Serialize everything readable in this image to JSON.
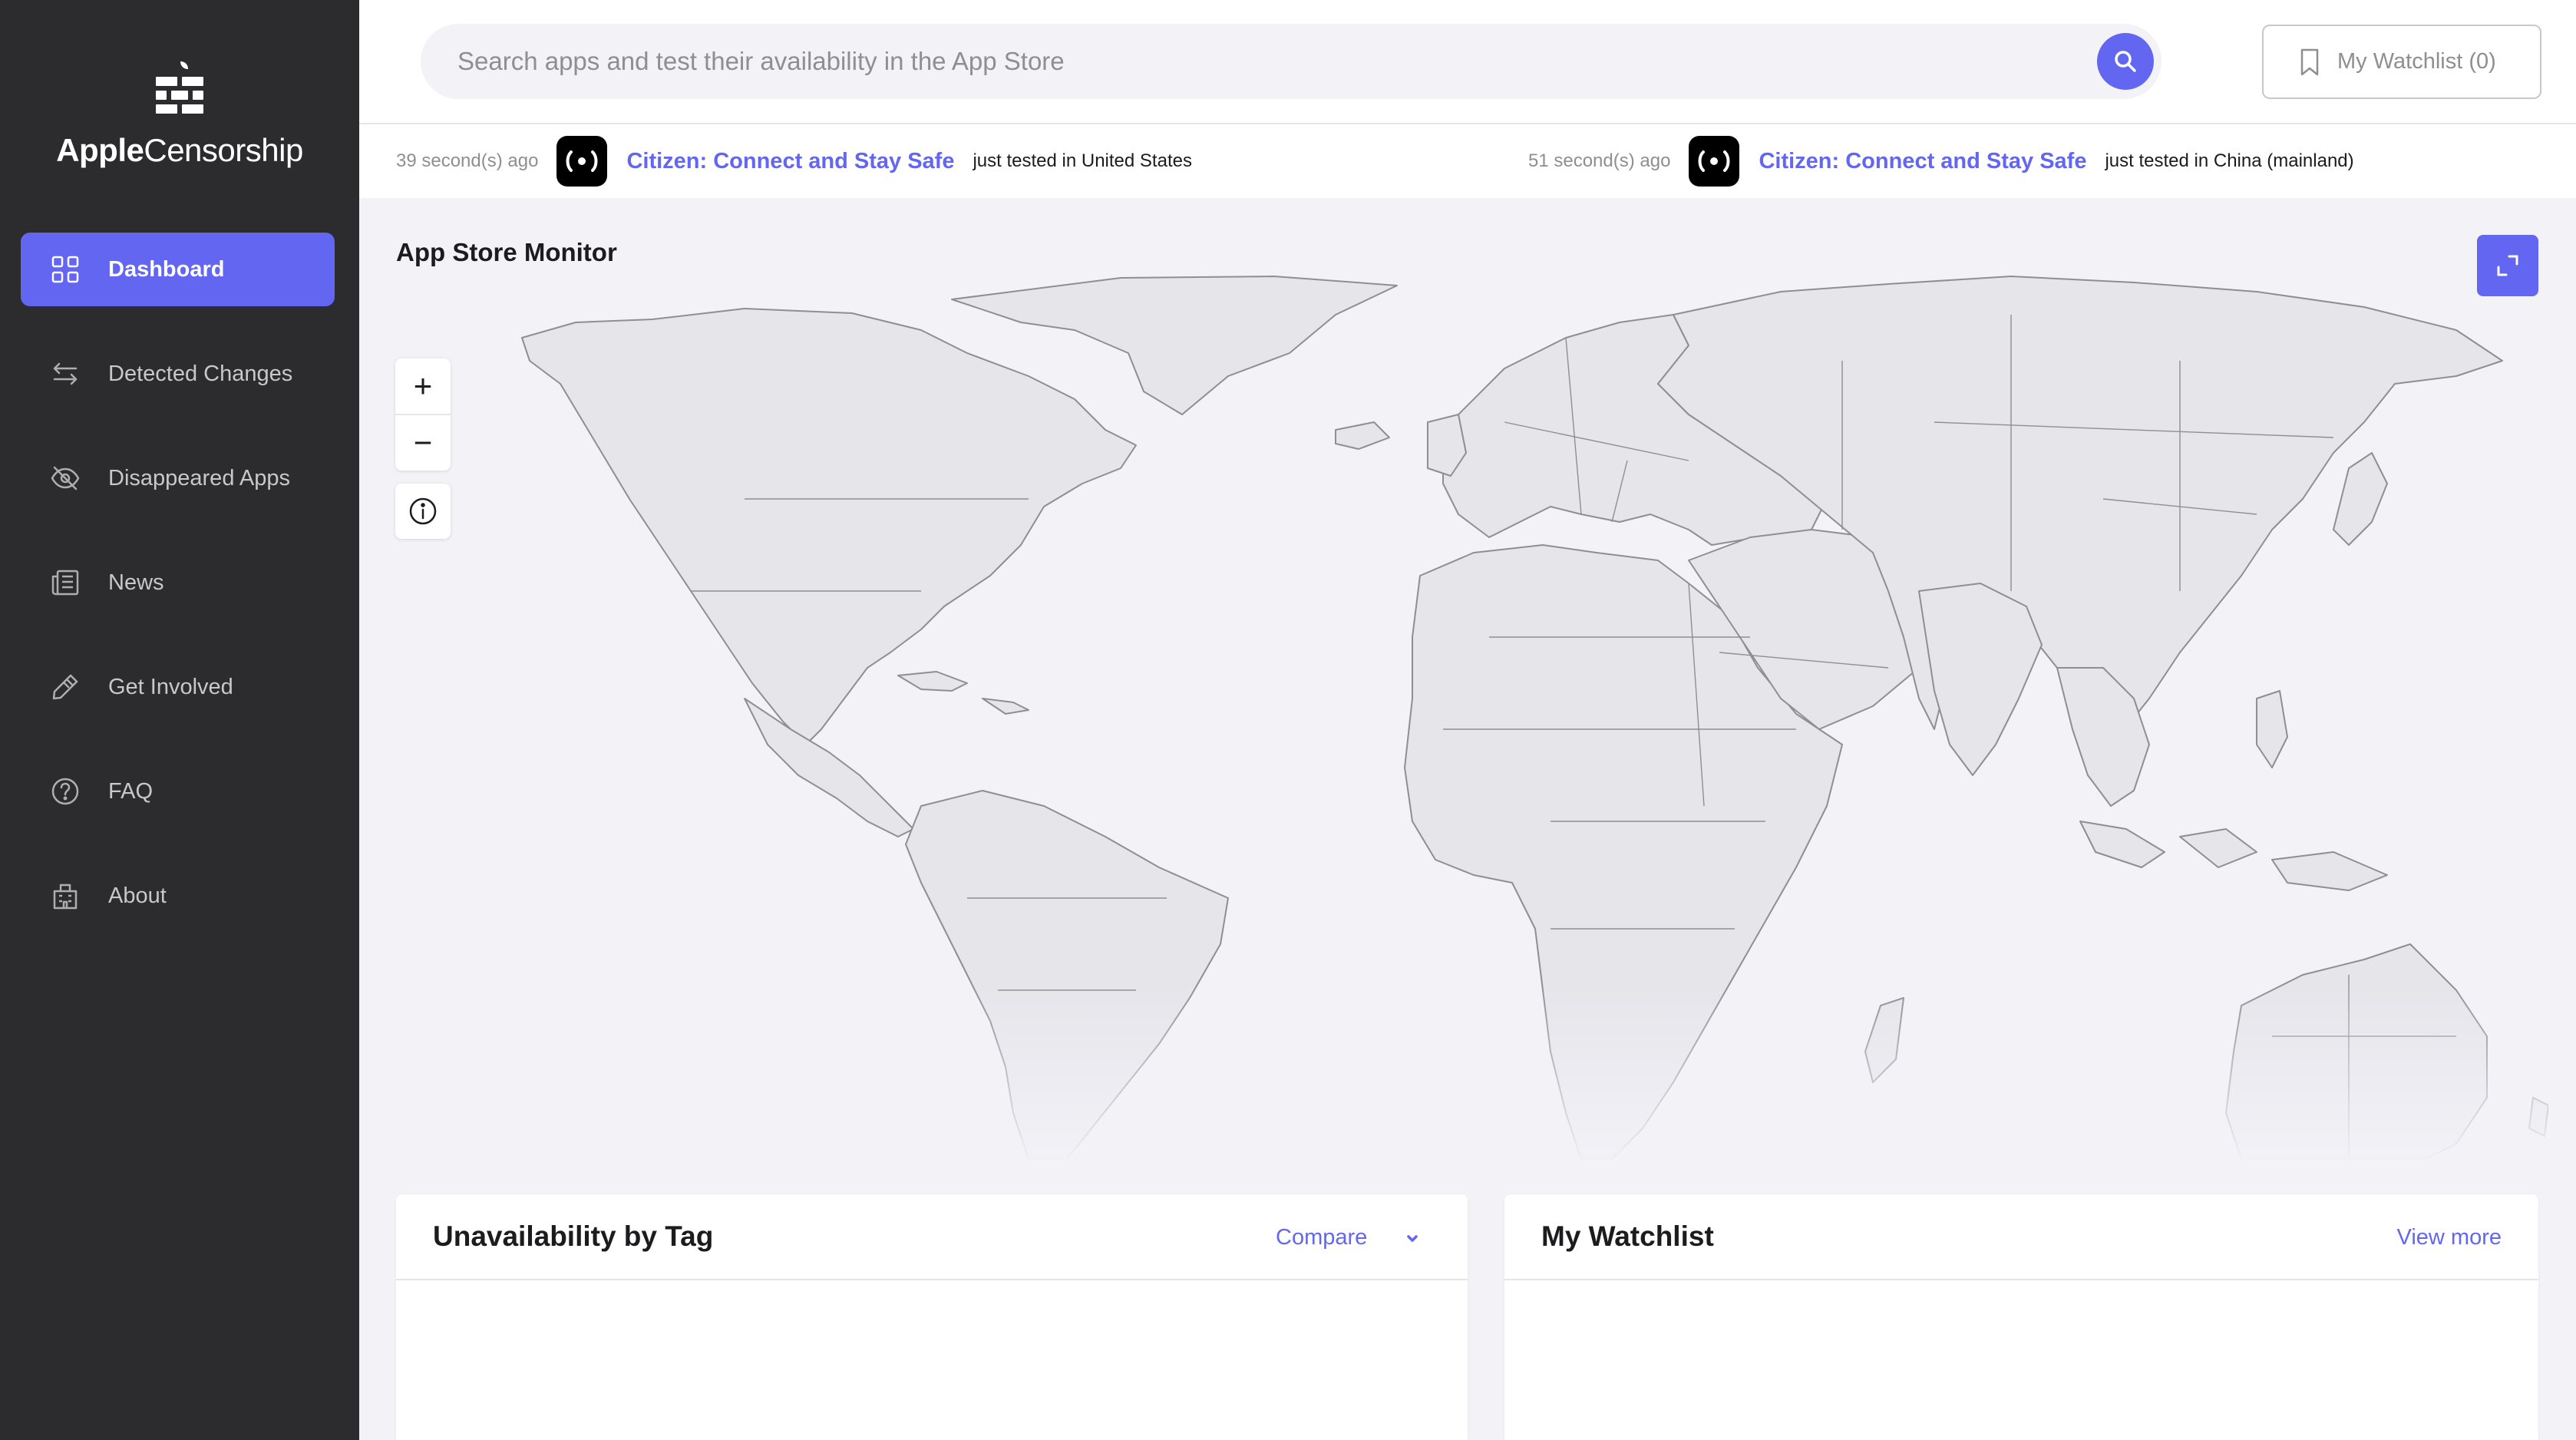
{
  "brand": {
    "name_bold": "Apple",
    "name_light": "Censorship"
  },
  "sidebar": {
    "items": [
      {
        "label": "Dashboard",
        "icon": "dashboard-grid-icon",
        "active": true
      },
      {
        "label": "Detected Changes",
        "icon": "swap-arrows-icon"
      },
      {
        "label": "Disappeared Apps",
        "icon": "eye-off-icon"
      },
      {
        "label": "News",
        "icon": "newspaper-icon"
      },
      {
        "label": "Get Involved",
        "icon": "pencil-icon"
      },
      {
        "label": "FAQ",
        "icon": "question-circle-icon"
      },
      {
        "label": "About",
        "icon": "building-icon"
      }
    ]
  },
  "header": {
    "search_placeholder": "Search apps and test their availability in the App Store",
    "watchlist_label": "My Watchlist (0)"
  },
  "ticker": [
    {
      "time": "39 second(s) ago",
      "app": "Citizen: Connect and Stay Safe",
      "status": "just tested in United States"
    },
    {
      "time": "51 second(s) ago",
      "app": "Citizen: Connect and Stay Safe",
      "status": "just tested in China (mainland)"
    }
  ],
  "map": {
    "title": "App Store Monitor",
    "zoom_in": "+",
    "zoom_out": "−"
  },
  "cards": {
    "tag": {
      "title": "Unavailability by Tag",
      "compare_label": "Compare"
    },
    "watchlist": {
      "title": "My Watchlist",
      "view_more_label": "View more"
    }
  },
  "colors": {
    "accent": "#6366f1",
    "sidebar_bg": "#2c2c2e",
    "page_bg": "#f2f2f7",
    "land": "#e5e5ea",
    "border": "#8e8e93"
  }
}
